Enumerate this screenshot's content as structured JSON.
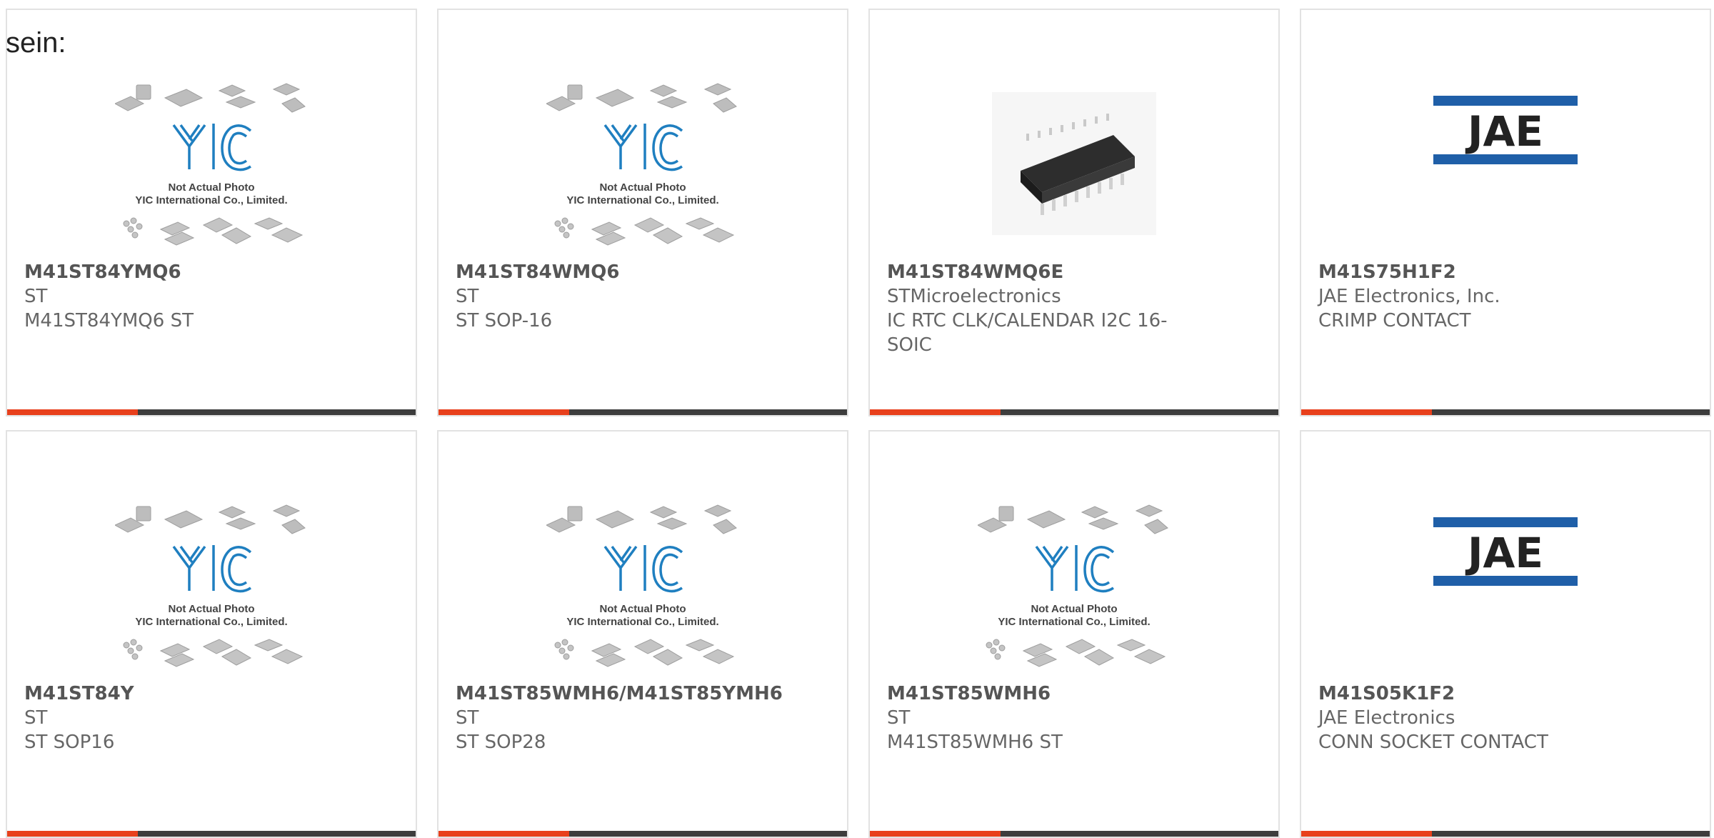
{
  "intro_text": "sein:",
  "accent_color": "#e8401c",
  "yic_caption": {
    "line1": "Not Actual Photo",
    "line2": "YIC International Co., Limited."
  },
  "jae_logo_text": "JAE",
  "products": [
    {
      "part": "M41ST84YMQ6",
      "mfr": "ST",
      "desc": "M41ST84YMQ6 ST",
      "image": "yic-placeholder"
    },
    {
      "part": "M41ST84WMQ6",
      "mfr": "ST",
      "desc": "ST SOP-16",
      "image": "yic-placeholder"
    },
    {
      "part": "M41ST84WMQ6E",
      "mfr": "STMicroelectronics",
      "desc": "IC RTC CLK/CALENDAR I2C 16-SOIC",
      "image": "soic-chip"
    },
    {
      "part": "M41S75H1F2",
      "mfr": "JAE Electronics, Inc.",
      "desc": "CRIMP CONTACT",
      "image": "jae-logo"
    },
    {
      "part": "M41ST84Y",
      "mfr": "ST",
      "desc": "ST SOP16",
      "image": "yic-placeholder"
    },
    {
      "part": "M41ST85WMH6/M41ST85YMH6",
      "mfr": "ST",
      "desc": "ST SOP28",
      "image": "yic-placeholder"
    },
    {
      "part": "M41ST85WMH6",
      "mfr": "ST",
      "desc": "M41ST85WMH6 ST",
      "image": "yic-placeholder"
    },
    {
      "part": "M41S05K1F2",
      "mfr": "JAE Electronics",
      "desc": "CONN SOCKET CONTACT",
      "image": "jae-logo"
    }
  ]
}
